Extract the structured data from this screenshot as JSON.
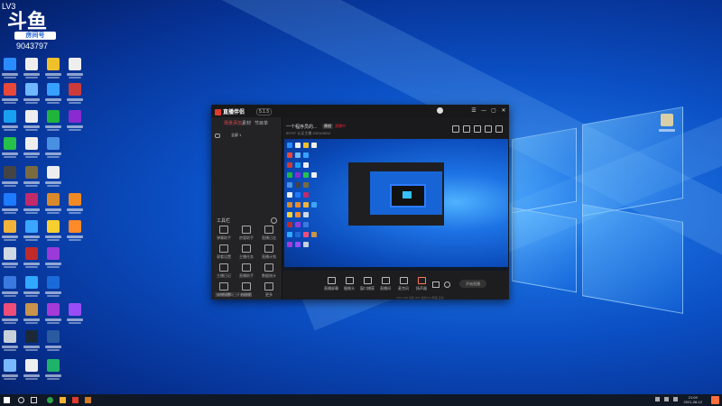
{
  "watermark": {
    "level": "LV3",
    "logo": "斗鱼",
    "badge": "房间号",
    "room": "9043797"
  },
  "desktop_icons": [
    {
      "id": "ie",
      "color": "#2b8cff"
    },
    {
      "id": "doc",
      "color": "#eeeeee"
    },
    {
      "id": "cloud",
      "color": "#f0c02a"
    },
    {
      "id": "file",
      "color": "#eeeeee"
    },
    {
      "id": "chrome",
      "color": "#e8473a"
    },
    {
      "id": "net",
      "color": "#6fb7ff"
    },
    {
      "id": "plane",
      "color": "#38a0ff"
    },
    {
      "id": "user",
      "color": "#cc3a3a"
    },
    {
      "id": "qq",
      "color": "#1aa0f0"
    },
    {
      "id": "doc2",
      "color": "#eeeeee"
    },
    {
      "id": "360",
      "color": "#20b43c"
    },
    {
      "id": "rar",
      "color": "#8a2ad0"
    },
    {
      "id": "wechat",
      "color": "#25c14a"
    },
    {
      "id": "doc3",
      "color": "#eeeeee"
    },
    {
      "id": "cube",
      "color": "#4a90e2"
    },
    {
      "id": "obs",
      "color": "#444444"
    },
    {
      "id": "game",
      "color": "#7a6a40"
    },
    {
      "id": "doc4",
      "color": "#eeeeee"
    },
    {
      "id": "shield",
      "color": "#1e7bff"
    },
    {
      "id": "rar2",
      "color": "#c22a6a"
    },
    {
      "id": "bird",
      "color": "#d88a2a"
    },
    {
      "id": "ring",
      "color": "#f08a24"
    },
    {
      "id": "folder",
      "color": "#f2b33a"
    },
    {
      "id": "flag",
      "color": "#3ba5ff"
    },
    {
      "id": "eye",
      "color": "#f7d030"
    },
    {
      "id": "orange",
      "color": "#ff8a2a"
    },
    {
      "id": "trash",
      "color": "#cfd8e3"
    },
    {
      "id": "box",
      "color": "#c02a2a"
    },
    {
      "id": "rar3",
      "color": "#9a3ad8"
    },
    {
      "id": "net2",
      "color": "#3a7ae0"
    },
    {
      "id": "ps",
      "color": "#31a8ff"
    },
    {
      "id": "k",
      "color": "#1b6ad9"
    },
    {
      "id": "color",
      "color": "#ee4d7a"
    },
    {
      "id": "pkg",
      "color": "#c9934a"
    },
    {
      "id": "rar4",
      "color": "#a53ad8"
    },
    {
      "id": "pr",
      "color": "#9b4df5"
    },
    {
      "id": "clock",
      "color": "#c8d0da"
    },
    {
      "id": "steam",
      "color": "#1b2838"
    },
    {
      "id": "img",
      "color": "#2a5aa0"
    },
    {
      "id": "glass",
      "color": "#7ab8ff"
    },
    {
      "id": "doc5",
      "color": "#eeeeee"
    },
    {
      "id": "play",
      "color": "#1fb36a"
    },
    {
      "id": "person",
      "color": "#d9d9d9"
    },
    {
      "id": "zip",
      "color": "#e6c276"
    },
    {
      "id": "edge",
      "color": "#2fa34a"
    }
  ],
  "app": {
    "logo": "直播伴侣",
    "version": "5.1.5",
    "window_buttons": [
      "☰",
      "—",
      "▢",
      "✕"
    ],
    "left_tabs": [
      "场景添加",
      "素材",
      "节目单"
    ],
    "scene_label": "全屏 1",
    "tools_title": "工具栏",
    "tools": [
      {
        "label": "弹幕助手"
      },
      {
        "label": "房管助手"
      },
      {
        "label": "直播日志"
      },
      {
        "label": "观看设置"
      },
      {
        "label": "主播任务"
      },
      {
        "label": "直播计划"
      },
      {
        "label": "主播日记"
      },
      {
        "label": "直播助手"
      },
      {
        "label": "数据统计"
      },
      {
        "label": "礼物设置"
      },
      {
        "label": "粉丝团"
      },
      {
        "label": "更多"
      }
    ],
    "left_status": "当前直播间已开启直播",
    "room_title": "一个程序员的...",
    "room_badge": "原创",
    "room_live": "直播中",
    "room_meta": "90797  认证主播  2021/08/12",
    "control_buttons": [
      {
        "label": "直播屏幕"
      },
      {
        "label": "摄像头"
      },
      {
        "label": "窗口捕获"
      },
      {
        "label": "直播间"
      },
      {
        "label": "麦克风"
      },
      {
        "label": "扬声器"
      }
    ],
    "go_live": "开始直播",
    "status_line": "CPU 12%  内存 36%  丢帧 0%  网络 正常"
  },
  "taskbar": {
    "time": "21:09",
    "date": "2021-08-12"
  }
}
